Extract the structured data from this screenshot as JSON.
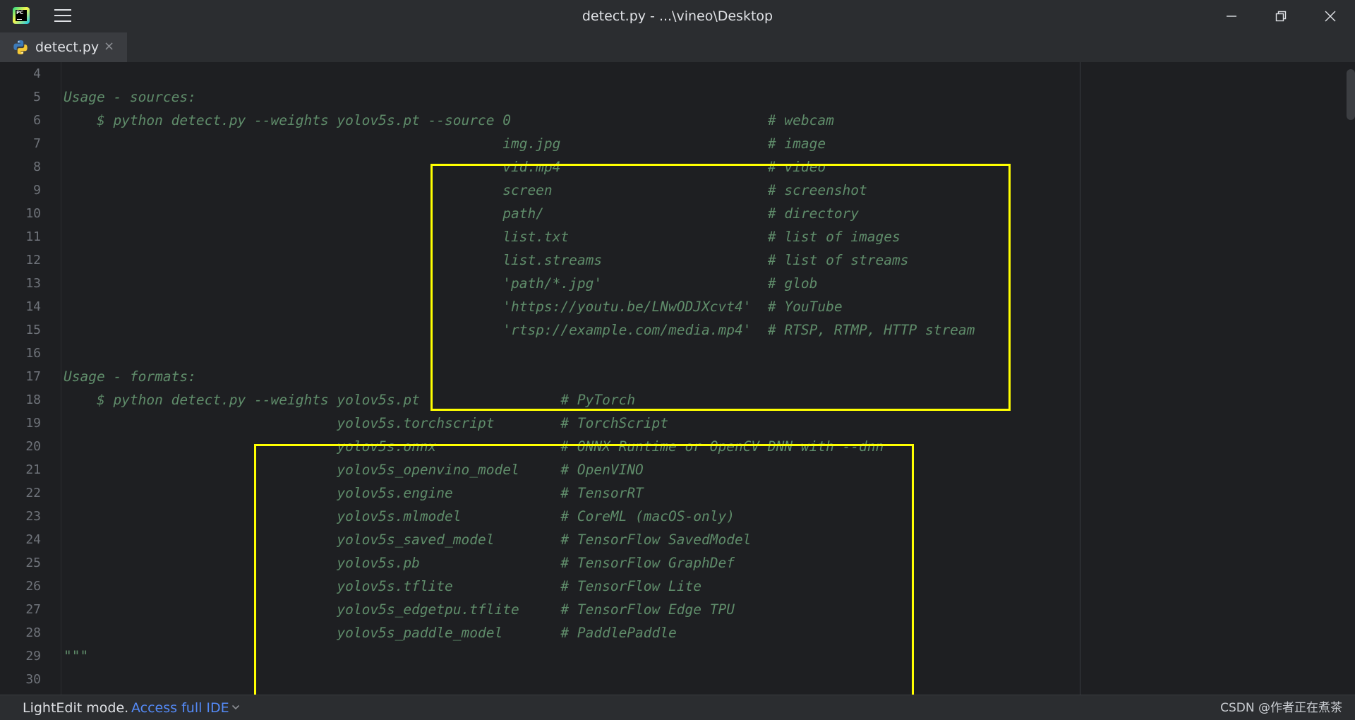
{
  "window": {
    "title": "detect.py - ...\\vineo\\Desktop",
    "logo_text": "PC"
  },
  "tabs": [
    {
      "label": "detect.py",
      "close_glyph": "×",
      "icon": "python-icon",
      "active": true
    }
  ],
  "code": {
    "comment_color": "#5f8c6a",
    "highlight_color": "#ffff00",
    "lines": [
      {
        "num": "4",
        "text": ""
      },
      {
        "num": "5",
        "text": "Usage - sources:"
      },
      {
        "num": "6",
        "text": "    $ python detect.py --weights yolov5s.pt --source 0                               # webcam"
      },
      {
        "num": "7",
        "text": "                                                     img.jpg                         # image"
      },
      {
        "num": "8",
        "text": "                                                     vid.mp4                         # video"
      },
      {
        "num": "9",
        "text": "                                                     screen                          # screenshot"
      },
      {
        "num": "10",
        "text": "                                                     path/                           # directory"
      },
      {
        "num": "11",
        "text": "                                                     list.txt                        # list of images"
      },
      {
        "num": "12",
        "text": "                                                     list.streams                    # list of streams"
      },
      {
        "num": "13",
        "text": "                                                     'path/*.jpg'                    # glob"
      },
      {
        "num": "14",
        "text": "                                                     'https://youtu.be/LNwODJXcvt4'  # YouTube"
      },
      {
        "num": "15",
        "text": "                                                     'rtsp://example.com/media.mp4'  # RTSP, RTMP, HTTP stream"
      },
      {
        "num": "16",
        "text": ""
      },
      {
        "num": "17",
        "text": "Usage - formats:"
      },
      {
        "num": "18",
        "text": "    $ python detect.py --weights yolov5s.pt                 # PyTorch"
      },
      {
        "num": "19",
        "text": "                                 yolov5s.torchscript        # TorchScript"
      },
      {
        "num": "20",
        "text": "                                 yolov5s.onnx               # ONNX Runtime or OpenCV DNN with --dnn"
      },
      {
        "num": "21",
        "text": "                                 yolov5s_openvino_model     # OpenVINO"
      },
      {
        "num": "22",
        "text": "                                 yolov5s.engine             # TensorRT"
      },
      {
        "num": "23",
        "text": "                                 yolov5s.mlmodel            # CoreML (macOS-only)"
      },
      {
        "num": "24",
        "text": "                                 yolov5s_saved_model        # TensorFlow SavedModel"
      },
      {
        "num": "25",
        "text": "                                 yolov5s.pb                 # TensorFlow GraphDef"
      },
      {
        "num": "26",
        "text": "                                 yolov5s.tflite             # TensorFlow Lite"
      },
      {
        "num": "27",
        "text": "                                 yolov5s_edgetpu.tflite     # TensorFlow Edge TPU"
      },
      {
        "num": "28",
        "text": "                                 yolov5s_paddle_model       # PaddlePaddle"
      },
      {
        "num": "29",
        "text": "\"\"\""
      },
      {
        "num": "30",
        "text": ""
      }
    ]
  },
  "status": {
    "mode_label": "LightEdit mode.",
    "access_link": "Access full IDE",
    "watermark": "CSDN @作者正在煮茶"
  }
}
